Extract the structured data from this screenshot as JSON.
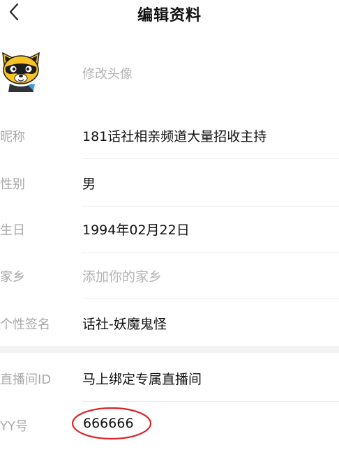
{
  "header": {
    "title": "编辑资料",
    "back_icon": "chevron-left-icon"
  },
  "avatar": {
    "icon": "raccoon-avatar-icon",
    "label": "修改头像"
  },
  "fields": [
    {
      "label": "昵称",
      "value": "181话社相亲频道大量招收主持",
      "placeholder": false
    },
    {
      "label": "性别",
      "value": "男",
      "placeholder": false
    },
    {
      "label": "生日",
      "value": "1994年02月22日",
      "placeholder": false
    },
    {
      "label": "家乡",
      "value": "添加你的家乡",
      "placeholder": true
    },
    {
      "label": "个性签名",
      "value": "话社-妖魔鬼怪",
      "placeholder": false
    }
  ],
  "account": [
    {
      "label": "直播间ID",
      "value": "马上绑定专属直播间"
    },
    {
      "label": "YY号",
      "value": "666666"
    }
  ],
  "colors": {
    "label": "#a8a8a8",
    "value": "#111111",
    "placeholder": "#b3b3b3",
    "annotation_circle": "#d9262a",
    "avatar_yellow": "#f7c325"
  }
}
